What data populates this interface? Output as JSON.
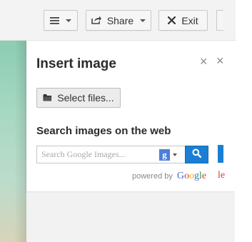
{
  "toolbar": {
    "menu_icon": "hamburger-icon",
    "share_label": "Share",
    "share_icon": "share-icon",
    "exit_label": "Exit",
    "exit_icon": "close-icon"
  },
  "dialog": {
    "title": "Insert image",
    "close_glyph": "×",
    "select_files_label": "Select files...",
    "select_files_icon": "folder-icon",
    "search_heading": "Search images on the web",
    "search_placeholder": "Search Google Images...",
    "provider_badge": "g",
    "search_icon": "search-icon",
    "powered_by": "powered by",
    "provider_logo_text": "Google",
    "edge_text": "le"
  },
  "colors": {
    "accent_blue": "#1a7fd4",
    "google_blue": "#3b6ed6",
    "google_red": "#d9412e",
    "google_yellow": "#f1b30a",
    "google_green": "#2a9a3b"
  }
}
